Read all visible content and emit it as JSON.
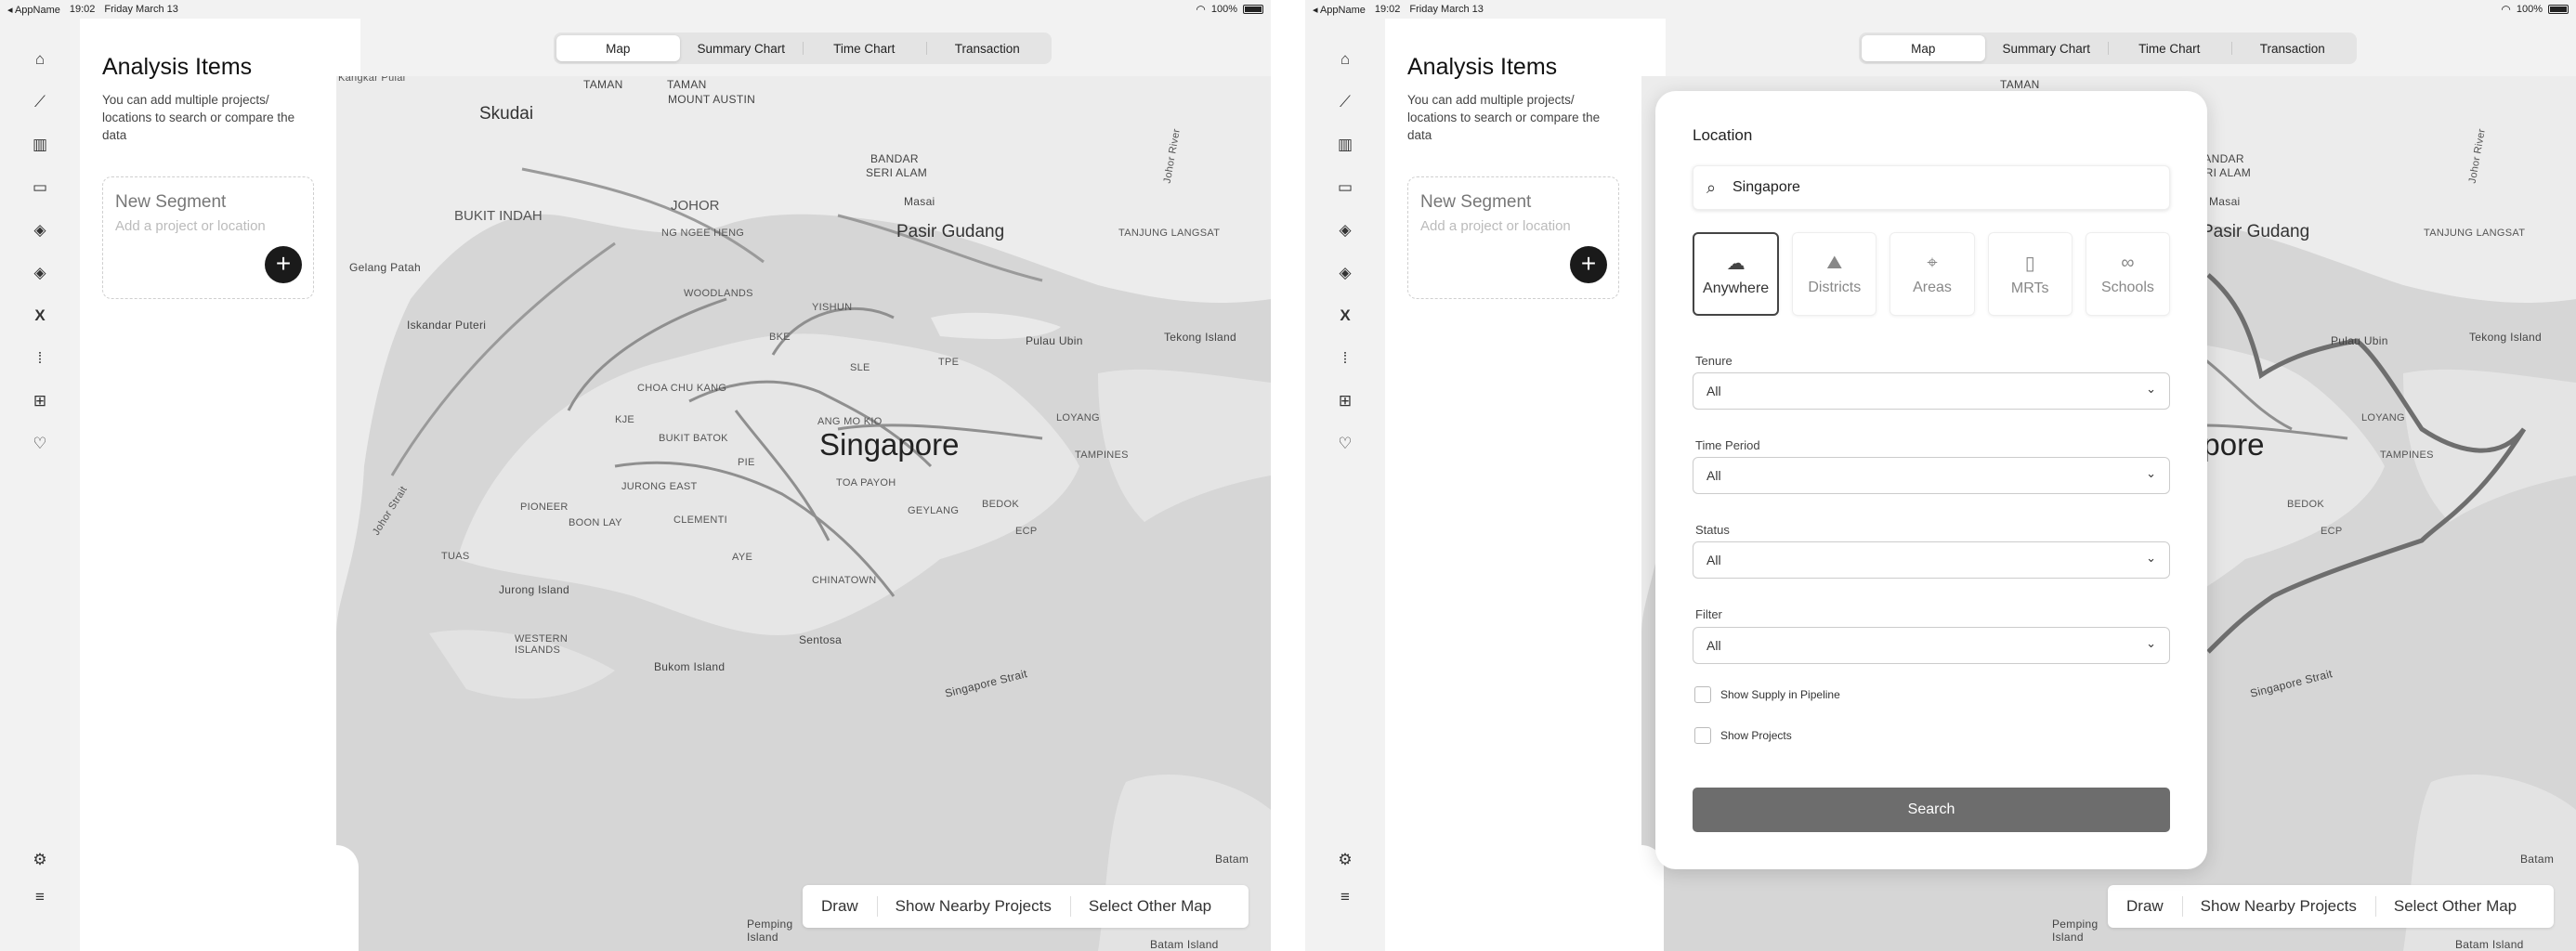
{
  "status": {
    "carrier": "◂ AppName",
    "time": "19:02",
    "date": "Friday March 13",
    "battery": "100%"
  },
  "rail_icons": [
    "home-icon",
    "chart-line-icon",
    "building-icon",
    "inbox-icon",
    "layers-icon",
    "layers-alt-icon",
    "x-icon",
    "grid-dots-icon",
    "add-document-icon",
    "heart-icon",
    "gear-icon",
    "menu-icon"
  ],
  "panel": {
    "title": "Analysis Items",
    "description": "You can add multiple projects/ locations to search or compare the data",
    "segment_title": "New Segment",
    "segment_placeholder": "Add a project or location"
  },
  "tabs": [
    {
      "label": "Map",
      "active": true
    },
    {
      "label": "Summary Chart",
      "active": false
    },
    {
      "label": "Time Chart",
      "active": false
    },
    {
      "label": "Transaction",
      "active": false
    }
  ],
  "map_labels": {
    "kangkar_pulai": "Kangkar Pulai",
    "skudai": "Skudai",
    "taman": "TAMAN",
    "mount_austin": "MOUNT AUSTIN",
    "bandar": "BANDAR",
    "seri_alam": "SERI ALAM",
    "johor_river": "Johor River",
    "bukit_indah": "BUKIT INDAH",
    "johor": "JOHOR",
    "ng_ngee_heng": "NG NGEE HENG",
    "masai": "Masai",
    "pasir_gudang": "Pasir Gudang",
    "tanjung_langsat": "TANJUNG LANGSAT",
    "gelang_patah": "Gelang Patah",
    "woodlands": "WOODLANDS",
    "yishun": "YISHUN",
    "iskandar_puteri": "Iskandar Puteri",
    "pulau_ubin": "Pulau Ubin",
    "tekong_island": "Tekong Island",
    "sle": "SLE",
    "tpe": "TPE",
    "kje": "KJE",
    "bke": "BKE",
    "choa_chu_kang": "CHOA CHU KANG",
    "ang_mo_kio": "ANG MO KIO",
    "loyang": "LOYANG",
    "bukit_batok": "BUKIT BATOK",
    "singapore": "Singapore",
    "tampines": "TAMPINES",
    "johor_strait": "Johor Strait",
    "pioneer": "PIONEER",
    "jurong_east": "JURONG EAST",
    "pie": "PIE",
    "toa_payoh": "TOA PAYOH",
    "bedok": "BEDOK",
    "boon_lay": "BOON LAY",
    "clementi": "CLEMENTI",
    "geylang": "GEYLANG",
    "ecp": "ECP",
    "tuas": "TUAS",
    "aye": "AYE",
    "jurong_island": "Jurong Island",
    "chinatown": "CHINATOWN",
    "western_islands": "WESTERN ISLANDS",
    "sentosa": "Sentosa",
    "bukom_island": "Bukom Island",
    "singapore_strait": "Singapore Strait",
    "batam": "Batam",
    "pemping_island": "Pemping Island",
    "batam_island": "Batam Island"
  },
  "map_actions": {
    "draw": "Draw",
    "nearby": "Show Nearby Projects",
    "other_map": "Select Other Map"
  },
  "modal": {
    "title": "Location",
    "search_value": "Singapore",
    "categories": [
      {
        "label": "Anywhere",
        "icon": "cloud-icon",
        "active": true
      },
      {
        "label": "Districts",
        "icon": "districts-icon",
        "active": false
      },
      {
        "label": "Areas",
        "icon": "map-pin-icon",
        "active": false
      },
      {
        "label": "MRTs",
        "icon": "train-icon",
        "active": false
      },
      {
        "label": "Schools",
        "icon": "glasses-icon",
        "active": false
      }
    ],
    "tenure_label": "Tenure",
    "tenure_value": "All",
    "time_label": "Time Period",
    "time_value": "All",
    "status_label": "Status",
    "status_value": "All",
    "filter_label": "Filter",
    "filter_value": "All",
    "check_supply": "Show Supply in Pipeline",
    "check_projects": "Show Projects",
    "search_button": "Search"
  }
}
